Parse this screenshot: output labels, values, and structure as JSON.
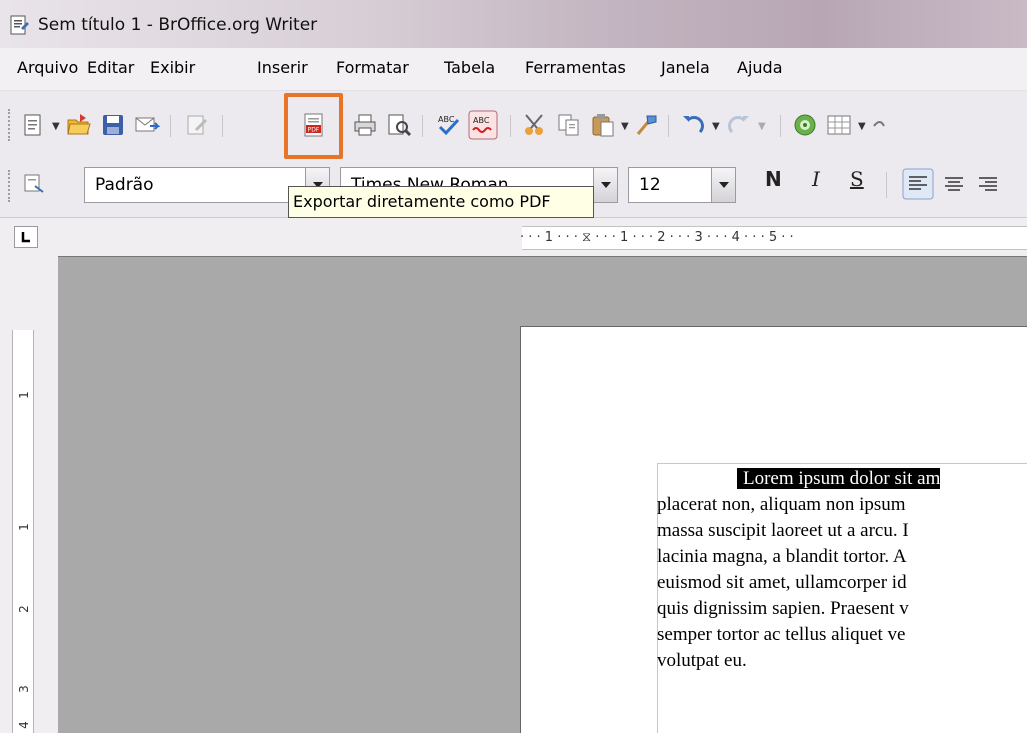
{
  "window": {
    "title": "Sem título 1 - BrOffice.org Writer"
  },
  "menu": [
    "Arquivo",
    "Editar",
    "Exibir",
    "Inserir",
    "Formatar",
    "Tabela",
    "Ferramentas",
    "Janela",
    "Ajuda"
  ],
  "toolbar": {
    "style_value": "Padrão",
    "font_value": "Times New Roman",
    "size_value": "12",
    "bold_label": "N",
    "italic_label": "I",
    "underline_label": "S",
    "highlighted_button": "export-pdf-button",
    "highlight_color": "#e8742a"
  },
  "tooltip": {
    "text": "Exportar diretamente como PDF"
  },
  "ruler": {
    "horizontal": "· · · 1 · · · ⧖ · · · 1 · · · 2 · · · 3 · · · 4 · · · 5 · ·",
    "vertical_marks": [
      "1",
      "1",
      "2",
      "3",
      "4"
    ]
  },
  "document": {
    "lines": [
      "Lorem ipsum dolor sit am",
      "placerat non, aliquam non ipsum",
      "massa suscipit laoreet ut a arcu. I",
      "lacinia magna, a blandit tortor. A",
      "euismod sit amet, ullamcorper id",
      "quis dignissim sapien. Praesent v",
      "semper tortor ac tellus aliquet ve",
      "volutpat eu."
    ]
  }
}
